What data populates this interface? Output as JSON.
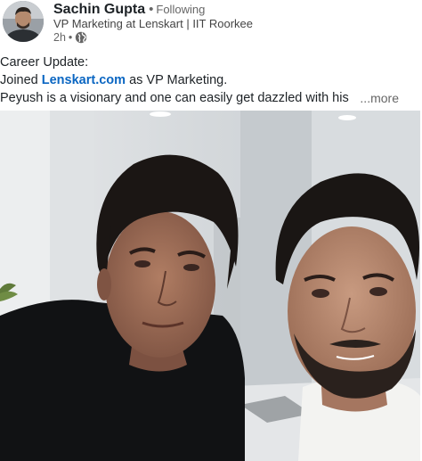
{
  "post": {
    "author": {
      "name": "Sachin Gupta",
      "follow_status": "Following",
      "headline": "VP Marketing at Lenskart | IIT Roorkee",
      "time_ago": "2h",
      "visibility_icon": "globe-icon"
    },
    "text": {
      "line1": "Career Update:",
      "line2_prefix": "Joined ",
      "line2_link": "Lenskart.com",
      "line2_suffix": " as VP Marketing.",
      "line3": "Peyush is a visionary and one can easily get dazzled with his",
      "see_more": "...more"
    },
    "colors": {
      "link": "#0a66c2",
      "muted": "#666666"
    }
  }
}
